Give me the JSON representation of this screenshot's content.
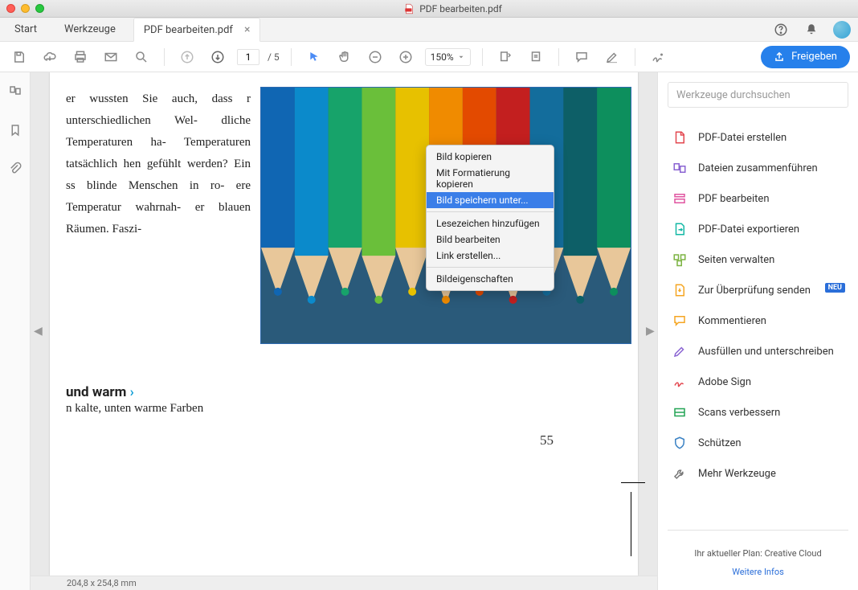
{
  "window_title": "PDF bearbeiten.pdf",
  "tabs": {
    "start": "Start",
    "tools": "Werkzeuge",
    "file": "PDF bearbeiten.pdf"
  },
  "toolbar": {
    "page_current": "1",
    "page_total": "/  5",
    "zoom": "150%",
    "share": "Freigeben"
  },
  "document": {
    "body_text": "er wussten Sie auch, dass r unterschiedlichen Wel- dliche Temperaturen ha- Temperaturen tatsächlich hen gefühlt werden? Ein ss blinde Menschen in ro- ere Temperatur wahrnah- er blauen Räumen. Faszi-",
    "heading": "und warm",
    "heading_arrow": "›",
    "subline": "n kalte, unten warme Farben",
    "page_number": "55"
  },
  "status": "204,8 x 254,8 mm",
  "right_panel": {
    "search_placeholder": "Werkzeuge durchsuchen",
    "tools": [
      "PDF-Datei erstellen",
      "Dateien zusammenführen",
      "PDF bearbeiten",
      "PDF-Datei exportieren",
      "Seiten verwalten",
      "Zur Überprüfung senden",
      "Kommentieren",
      "Ausfüllen und unterschreiben",
      "Adobe Sign",
      "Scans verbessern",
      "Schützen",
      "Mehr Werkzeuge"
    ],
    "new_badge": "NEU",
    "plan": "Ihr aktueller Plan: Creative Cloud",
    "more_info": "Weitere Infos"
  },
  "context_menu": {
    "items": [
      "Bild kopieren",
      "Mit Formatierung kopieren",
      "Bild speichern unter...",
      "Lesezeichen hinzufügen",
      "Bild bearbeiten",
      "Link erstellen...",
      "Bildeigenschaften"
    ],
    "highlighted_index": 2
  }
}
